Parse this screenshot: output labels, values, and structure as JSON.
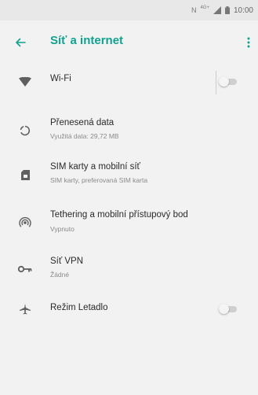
{
  "status_bar": {
    "nfc": "N",
    "network": "4G+",
    "time": "10:00"
  },
  "app_bar": {
    "title": "Síť a internet",
    "back_icon": "arrow-left-icon",
    "more_icon": "more-vert-icon"
  },
  "colors": {
    "accent": "#11a28f",
    "icon": "#5f5f5f",
    "toggle_off_track": "#cfcfcf"
  },
  "items": [
    {
      "id": "wifi",
      "icon": "wifi-icon",
      "label": "Wi-Fi",
      "subtitle": "",
      "toggle": false
    },
    {
      "id": "data-usage",
      "icon": "data-usage-icon",
      "label": "Přenesená data",
      "subtitle": "Využitá data: 29,72 MB"
    },
    {
      "id": "sim",
      "icon": "sim-card-icon",
      "label": "SIM karty a mobilní síť",
      "subtitle": "SIM karty, preferovaná SIM karta"
    },
    {
      "id": "tethering",
      "icon": "hotspot-icon",
      "label": "Tethering a mobilní přístupový bod",
      "subtitle": "Vypnuto"
    },
    {
      "id": "vpn",
      "icon": "vpn-key-icon",
      "label": "Síť VPN",
      "subtitle": "Žádné"
    },
    {
      "id": "airplane",
      "icon": "airplane-icon",
      "label": "Režim Letadlo",
      "subtitle": "",
      "toggle": false
    }
  ]
}
